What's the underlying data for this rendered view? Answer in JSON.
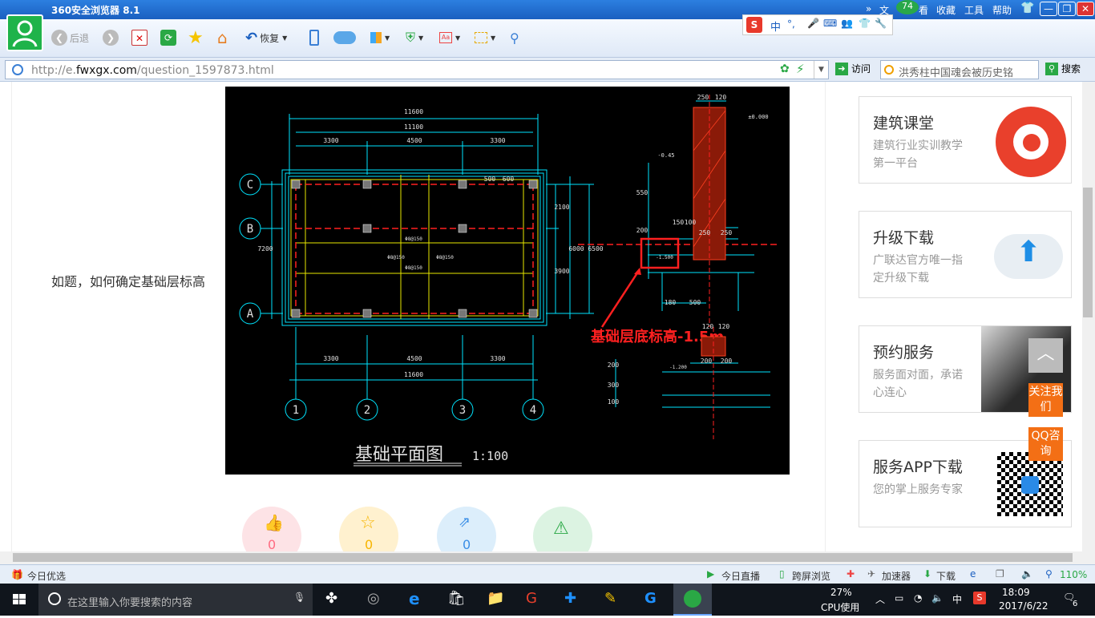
{
  "window": {
    "title": "360安全浏览器 8.1",
    "menu": [
      "文",
      "看",
      "收藏",
      "工具",
      "帮助"
    ],
    "badge": "74",
    "controls": [
      "—",
      "❐",
      "✕"
    ]
  },
  "toolbar": {
    "back_label": "后退",
    "undo_label": "恢复"
  },
  "ime": {
    "lang": "中",
    "dot": "°,"
  },
  "address": {
    "url_prefix": "http://e.",
    "url_domain": "fwxgx.com",
    "url_path": "/question_1597873.html",
    "visit_label": "访问",
    "search_value": "洪秀柱中国魂会被历史铭",
    "search_label": "搜索"
  },
  "page": {
    "question_text": "如题，如何确定基础层标高",
    "action_counts": [
      "0",
      "0",
      "0"
    ]
  },
  "cad": {
    "overall_top": "11600",
    "inner_top": "11100",
    "top_bays": [
      "3300",
      "4500",
      "3300"
    ],
    "bottom_bays": [
      "3300",
      "4500",
      "3300"
    ],
    "overall_bottom": "11600",
    "row_labels": [
      "C",
      "B",
      "A"
    ],
    "col_labels": [
      "1",
      "2",
      "3",
      "4"
    ],
    "right_dims": [
      "2100",
      "3900",
      "6000",
      "6500"
    ],
    "left_dim": "7200",
    "top_small": [
      "500",
      "600"
    ],
    "plan_title": "基础平面图",
    "scale": "1:100",
    "annotation": "基础层底标高-1.5m",
    "detail_dims_top": [
      "250",
      "120"
    ],
    "detail_elev_top": "±0.000",
    "detail_elev_mid": "-0.45",
    "detail_dim_550": "550",
    "detail_dims_mid": [
      "150",
      "100"
    ],
    "detail_dims_250": [
      "250",
      "250"
    ],
    "detail_dim_200": "200",
    "detail_elev_low": "-1.500",
    "detail_dims_bottom": [
      "180",
      "500"
    ],
    "detail2_dims_top": [
      "120",
      "120"
    ],
    "detail2_elev": "-1.200",
    "detail2_dims": [
      "200",
      "200"
    ],
    "detail2_side": [
      "200",
      "300",
      "100"
    ],
    "rebar_labels": [
      "Φ8@150",
      "Φ8@150",
      "Φ8@150",
      "Φ8@150"
    ]
  },
  "sidebar": {
    "cards": [
      {
        "title": "建筑课堂",
        "desc": "建筑行业实训教学第一平台"
      },
      {
        "title": "升级下载",
        "desc": "广联达官方唯一指定升级下载"
      },
      {
        "title": "预约服务",
        "desc": "服务面对面，承诺心连心"
      },
      {
        "title": "服务APP下载",
        "desc": "您的掌上服务专家"
      }
    ],
    "follow_label": "关注我们",
    "qq_label": "QQ咨询"
  },
  "statusbar": {
    "left": "今日优选",
    "items": [
      "今日直播",
      "跨屏浏览",
      "加速器",
      "下载"
    ],
    "zoom": "110%"
  },
  "taskbar": {
    "search_placeholder": "在这里输入你要搜索的内容",
    "cpu_percent": "27%",
    "cpu_label": "CPU使用",
    "ime": "中",
    "time": "18:09",
    "date": "2017/6/22",
    "notification_count": "6"
  },
  "colors": {
    "accent": "#2c7fe0",
    "cad_cyan": "#00e5ff",
    "cad_yellow": "#e8e800",
    "cad_red": "#ff2020",
    "wall_fill": "#8a1a08",
    "side_orange": "#f36f15"
  }
}
